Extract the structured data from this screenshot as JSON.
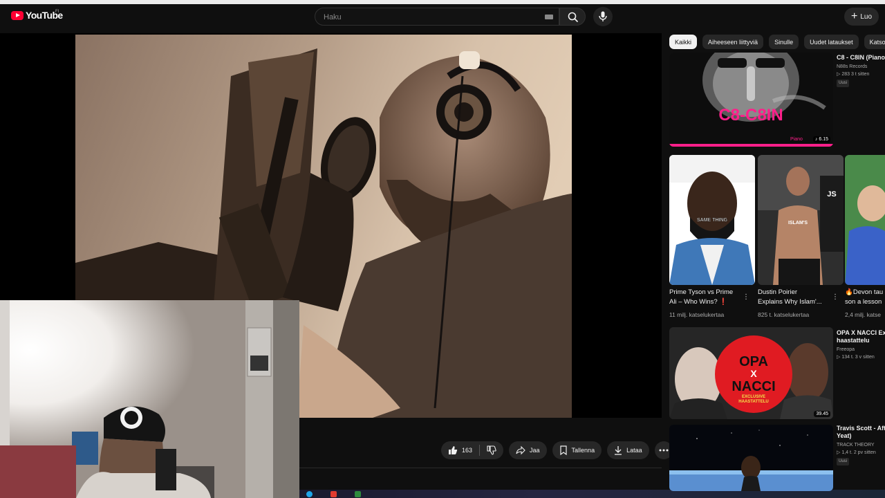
{
  "header": {
    "logo_text": "YouTube",
    "region_code": "FI",
    "search_placeholder": "Haku",
    "create_label": "Luo"
  },
  "actions": {
    "like_count": "163",
    "share_label": "Jaa",
    "save_label": "Tallenna",
    "download_label": "Lataa"
  },
  "chips": [
    "Kaikki",
    "Aiheeseen liittyviä",
    "Sinulle",
    "Uudet lataukset",
    "Katsot"
  ],
  "recommendations": [
    {
      "title": "C8 - C8IN (Piano",
      "channel": "N88s Records",
      "stats": "283  3 t sitten",
      "badge": "Uusi",
      "thumb_text": "C8-C8IN",
      "thumb_sub": "Piano",
      "duration": "6.15"
    },
    {
      "title": "OPA X NACCI Exc",
      "title2": "haastattelu",
      "channel": "Freeopa",
      "stats": "134 t.  3 v sitten",
      "thumb_line1": "OPA",
      "thumb_line2": "X",
      "thumb_line3": "NACCI",
      "thumb_line4": "EXCLUSIVE",
      "thumb_line5": "HAASTATTELU",
      "duration": "39.45"
    },
    {
      "title": "Travis Scott - Aft",
      "title2": "Yeat)",
      "channel": "TRACK THEORY",
      "stats": "1,4 t.  2 pv sitten",
      "badge": "Uusi"
    }
  ],
  "shorts": [
    {
      "title_line1": "Prime Tyson vs Prime",
      "title_line2": "Ali – Who Wins? ❗",
      "views": "11 milj. katselukertaa",
      "caption": "SAME THING"
    },
    {
      "title_line1": "Dustin Poirier",
      "title_line2": "Explains Why Islam'...",
      "views": "825 t. katselukertaa",
      "caption": "ISLAM'S"
    },
    {
      "title_line1": "🔥Devon tau",
      "title_line2": "son a lesson",
      "views": "2,4 milj. katse"
    }
  ],
  "colors": {
    "background": "#0f0f0f",
    "chip": "#272727",
    "chip_active": "#f1f1f1",
    "brand_red": "#ff0033",
    "opa_red": "#e01b22",
    "c8_pink": "#ff1f8a"
  }
}
